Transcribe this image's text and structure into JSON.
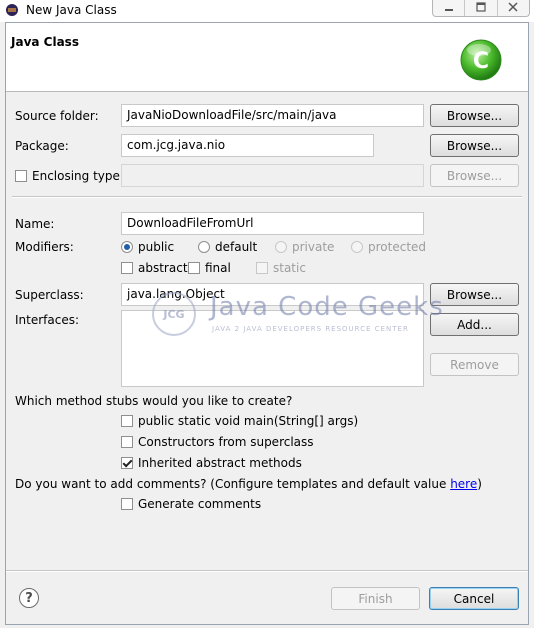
{
  "window": {
    "title": "New Java Class",
    "minimize_icon": "minimize-icon",
    "maximize_icon": "maximize-icon",
    "close_icon": "close-icon"
  },
  "header": {
    "title": "Java Class",
    "logo": "new-class-icon",
    "logo_letter": "C"
  },
  "form": {
    "source_folder": {
      "label": "Source folder:",
      "value": "JavaNioDownloadFile/src/main/java",
      "browse": "Browse..."
    },
    "package": {
      "label": "Package:",
      "value": "com.jcg.java.nio",
      "browse": "Browse..."
    },
    "enclosing_type": {
      "label": "Enclosing type:",
      "checked": false,
      "value": "",
      "browse": "Browse..."
    },
    "name": {
      "label": "Name:",
      "value": "DownloadFileFromUrl"
    },
    "modifiers": {
      "label": "Modifiers:",
      "public": "public",
      "default": "default",
      "private": "private",
      "protected": "protected",
      "selected": "public",
      "abstract": "abstract",
      "final": "final",
      "static": "static"
    },
    "superclass": {
      "label": "Superclass:",
      "value": "java.lang.Object",
      "browse": "Browse..."
    },
    "interfaces": {
      "label": "Interfaces:",
      "add": "Add...",
      "remove": "Remove",
      "items": []
    },
    "method_stubs": {
      "question": "Which method stubs would you like to create?",
      "main": {
        "label": "public static void main(String[] args)",
        "checked": false
      },
      "constructors": {
        "label": "Constructors from superclass",
        "checked": false
      },
      "inherited": {
        "label": "Inherited abstract methods",
        "checked": true
      }
    },
    "comments": {
      "question": "Do you want to add comments? (Configure templates and default value ",
      "link": "here",
      "suffix": ")",
      "generate": {
        "label": "Generate comments",
        "checked": false
      }
    }
  },
  "watermark": {
    "badge": "JCG",
    "text": "Java Code Geeks",
    "sub": "JAVA 2 JAVA DEVELOPERS RESOURCE CENTER"
  },
  "footer": {
    "help_icon": "help-icon",
    "help_glyph": "?",
    "finish": "Finish",
    "cancel": "Cancel"
  },
  "colors": {
    "accent": "#1f5fa8",
    "logo_green": "#3fae2a",
    "link": "#0000ee"
  }
}
